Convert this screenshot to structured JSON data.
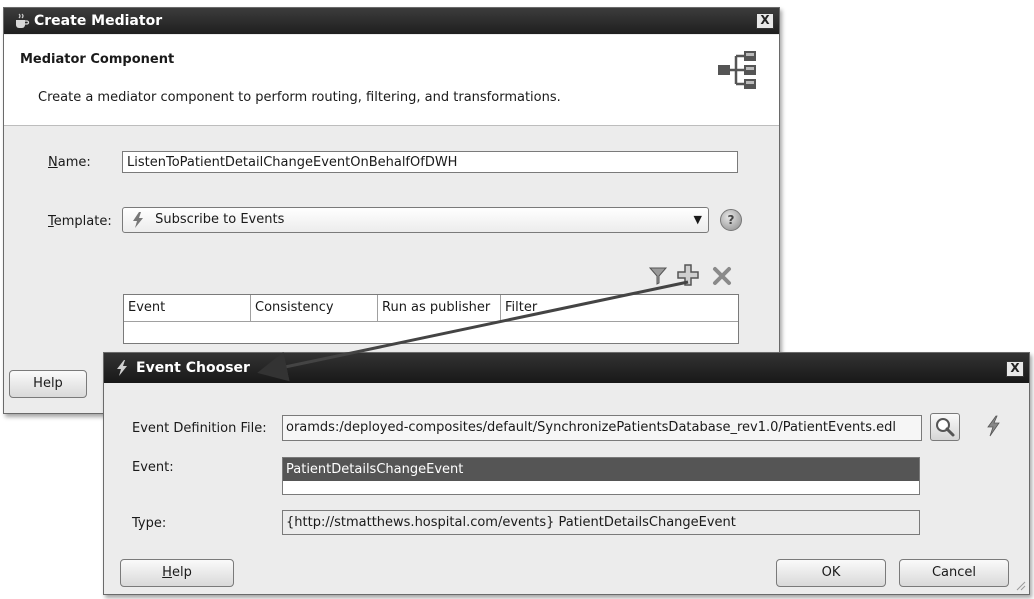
{
  "create_mediator": {
    "title": "Create Mediator",
    "close": "X",
    "header_title": "Mediator Component",
    "header_desc": "Create a mediator component to perform routing, filtering, and transformations.",
    "name_label": "Name:",
    "name_value": "ListenToPatientDetailChangeEventOnBehalfOfDWH",
    "template_label": "Template:",
    "template_value": "Subscribe to Events",
    "table_columns": [
      "Event",
      "Consistency",
      "Run as publisher",
      "Filter"
    ],
    "help_label": "Help"
  },
  "event_chooser": {
    "title": "Event Chooser",
    "close": "X",
    "edf_label": "Event Definition File:",
    "edf_value": "oramds:/deployed-composites/default/SynchronizePatientsDatabase_rev1.0/PatientEvents.edl",
    "event_label": "Event:",
    "event_selected": "PatientDetailsChangeEvent",
    "type_label": "Type:",
    "type_value": "{http://stmatthews.hospital.com/events} PatientDetailsChangeEvent",
    "help_label": "Help",
    "ok_label": "OK",
    "cancel_label": "Cancel"
  },
  "icons": {
    "title_icon": "java-cup-icon",
    "mediator_icon": "mediator-tree-icon",
    "template_icon": "lightning-icon",
    "help_icon": "help-circle-icon",
    "filter_icon": "filter-icon",
    "add_icon": "plus-icon",
    "delete_icon": "x-icon",
    "search_icon": "search-icon",
    "event_icon": "lightning-icon"
  },
  "colors": {
    "titlebar": "#2e2e2e",
    "selected_row": "#555555"
  }
}
